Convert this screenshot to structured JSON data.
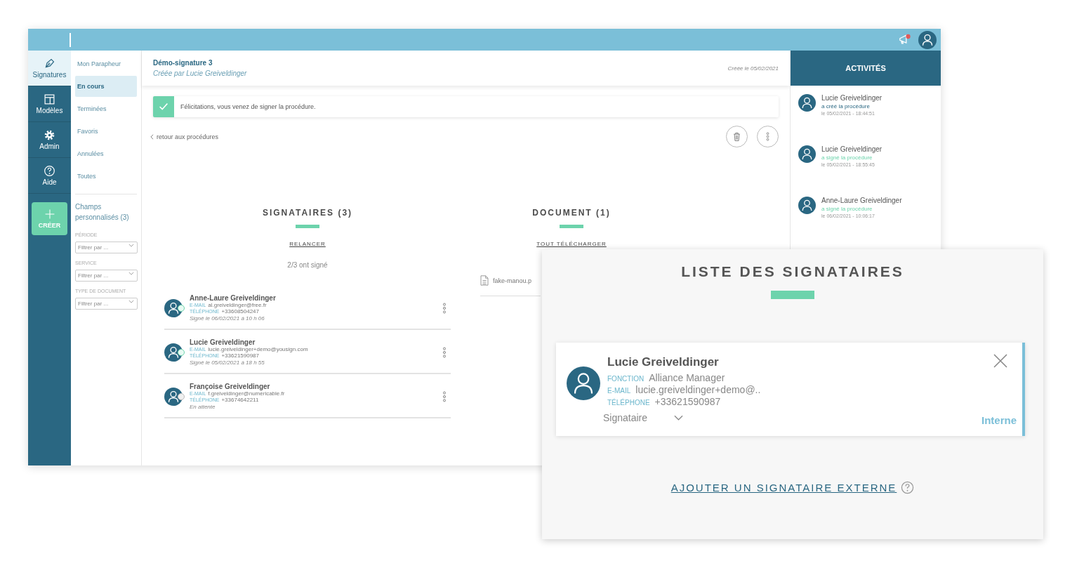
{
  "rail": {
    "items": [
      {
        "label": "Signatures",
        "selected": true
      },
      {
        "label": "Modèles",
        "selected": false
      },
      {
        "label": "Admin",
        "selected": false
      },
      {
        "label": "Aide",
        "selected": false
      }
    ],
    "create": "CRÉER"
  },
  "subnav": {
    "items": [
      {
        "label": "Mon Parapheur",
        "selected": false
      },
      {
        "label": "En cours",
        "selected": true
      },
      {
        "label": "Terminées",
        "selected": false
      },
      {
        "label": "Favoris",
        "selected": false
      },
      {
        "label": "Annulées",
        "selected": false
      },
      {
        "label": "Toutes",
        "selected": false
      }
    ],
    "custom_fields": "Champs personnalisés (3)",
    "filters": [
      {
        "label": "PÉRIODE",
        "placeholder": "Filtrer par ..."
      },
      {
        "label": "SERVICE",
        "placeholder": "Filtrer par ..."
      },
      {
        "label": "TYPE DE DOCUMENT",
        "placeholder": "Filtrer par ..."
      }
    ]
  },
  "header": {
    "title": "Démo-signature 3",
    "subtitle": "Créée par Lucie Greiveldinger",
    "created": "Créée le 05/02/2021"
  },
  "alert": {
    "text": "Félicitations, vous venez de signer la procédure."
  },
  "back_link": "retour aux procédures",
  "signers": {
    "title": "SIGNATAIRES (3)",
    "action": "RELANCER",
    "summary": "2/3 ont signé",
    "items": [
      {
        "name": "Anne-Laure Greiveldinger",
        "email_label": "E-MAIL",
        "email": "al.greiveldinger@free.fr",
        "phone_label": "TÉLÉPHONE",
        "phone": "+33608504247",
        "status": "Signé le 06/02/2021 à 10 h 06",
        "signed": true
      },
      {
        "name": "Lucie Greiveldinger",
        "email_label": "E-MAIL",
        "email": "lucie.greiveldinger+demo@yousign.com",
        "phone_label": "TÉLÉPHONE",
        "phone": "+33621590987",
        "status": "Signé le 05/02/2021 à 18 h 55",
        "signed": true
      },
      {
        "name": "Françoise Greiveldinger",
        "email_label": "E-MAIL",
        "email": "f.greiveldinger@numericable.fr",
        "phone_label": "TÉLÉPHONE",
        "phone": "+33674642211",
        "status": "En attente",
        "signed": false
      }
    ]
  },
  "document": {
    "title": "DOCUMENT (1)",
    "action": "TOUT TÉLÉCHARGER",
    "files": [
      "fake-manou.p"
    ]
  },
  "activities": {
    "title": "ACTIVITÉS",
    "items": [
      {
        "name": "Lucie Greiveldinger",
        "action": "a créé la procédure",
        "kind": "created",
        "date": "le 05/02/2021 - 18:44:51"
      },
      {
        "name": "Lucie Greiveldinger",
        "action": "a signé la procédure",
        "kind": "signed",
        "date": "le 05/02/2021 - 18:55:45"
      },
      {
        "name": "Anne-Laure Greiveldinger",
        "action": "a signé la procédure",
        "kind": "signed",
        "date": "le 06/02/2021 - 10:06:17"
      }
    ]
  },
  "modal": {
    "title": "LISTE DES SIGNATAIRES",
    "card": {
      "name": "Lucie Greiveldinger",
      "fields": [
        {
          "label": "FONCTION",
          "value": "Alliance Manager"
        },
        {
          "label": "E-MAIL",
          "value": "lucie.greiveldinger+demo@.."
        },
        {
          "label": "TÉLÉPHONE",
          "value": "+33621590987"
        }
      ],
      "role": "Signataire",
      "type": "Interne"
    },
    "link": "AJOUTER UN SIGNATAIRE EXTERNE"
  }
}
